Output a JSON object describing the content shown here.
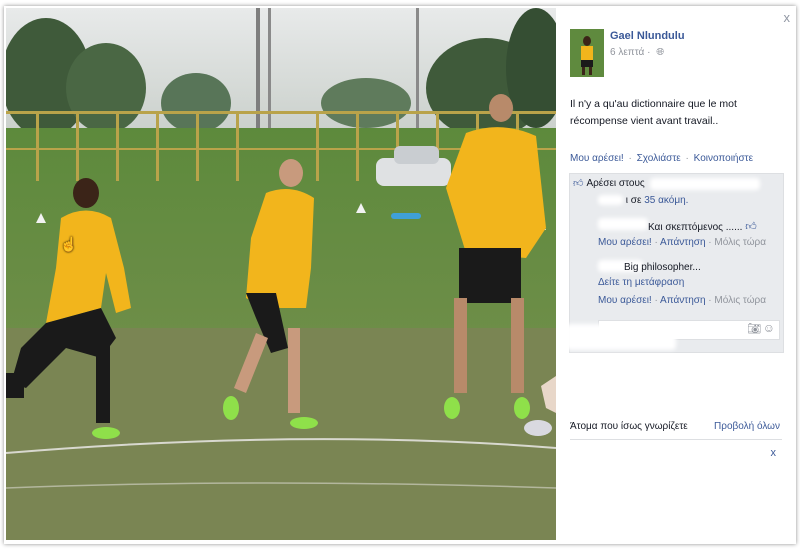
{
  "photo": {
    "description_icon": "photo-football-training"
  },
  "post": {
    "author": "Gael Nlundulu",
    "time": "6 λεπτά",
    "audience_icon": "globe-icon",
    "text": "Il n'y a qu'au dictionnaire que le mot récompense vient avant travail..",
    "actions": {
      "like": "Μου αρέσει!",
      "comment": "Σχολιάστε",
      "share": "Κοινοποιήστε",
      "separator": "·"
    }
  },
  "ufi": {
    "likes_prefix": "Αρέσει στους",
    "likes_suffix_pre": "ι σε ",
    "likes_more_link": "35 ακόμη.",
    "comment1_text": "Και σκεπτόμενος ......",
    "comment1_actions": {
      "like": "Μου αρέσει!",
      "reply": "Απάντηση",
      "time": "Μόλις τώρα"
    },
    "comment2_text": "Big philosopher...",
    "translate": "Δείτε τη μετάφραση",
    "comment2_actions": {
      "like": "Μου αρέσει!",
      "reply": "Απάντηση",
      "time": "Μόλις τώρα"
    }
  },
  "sidebar": {
    "people_you_may_know": "Άτομα που ίσως γνωρίζετε",
    "view_all": "Προβολή όλων",
    "close": "x"
  },
  "window": {
    "close": "x"
  },
  "colors": {
    "link": "#3b5998",
    "muted": "#90949c",
    "ufi_bg": "#e9ebee",
    "kit_yellow": "#f2b51c"
  }
}
